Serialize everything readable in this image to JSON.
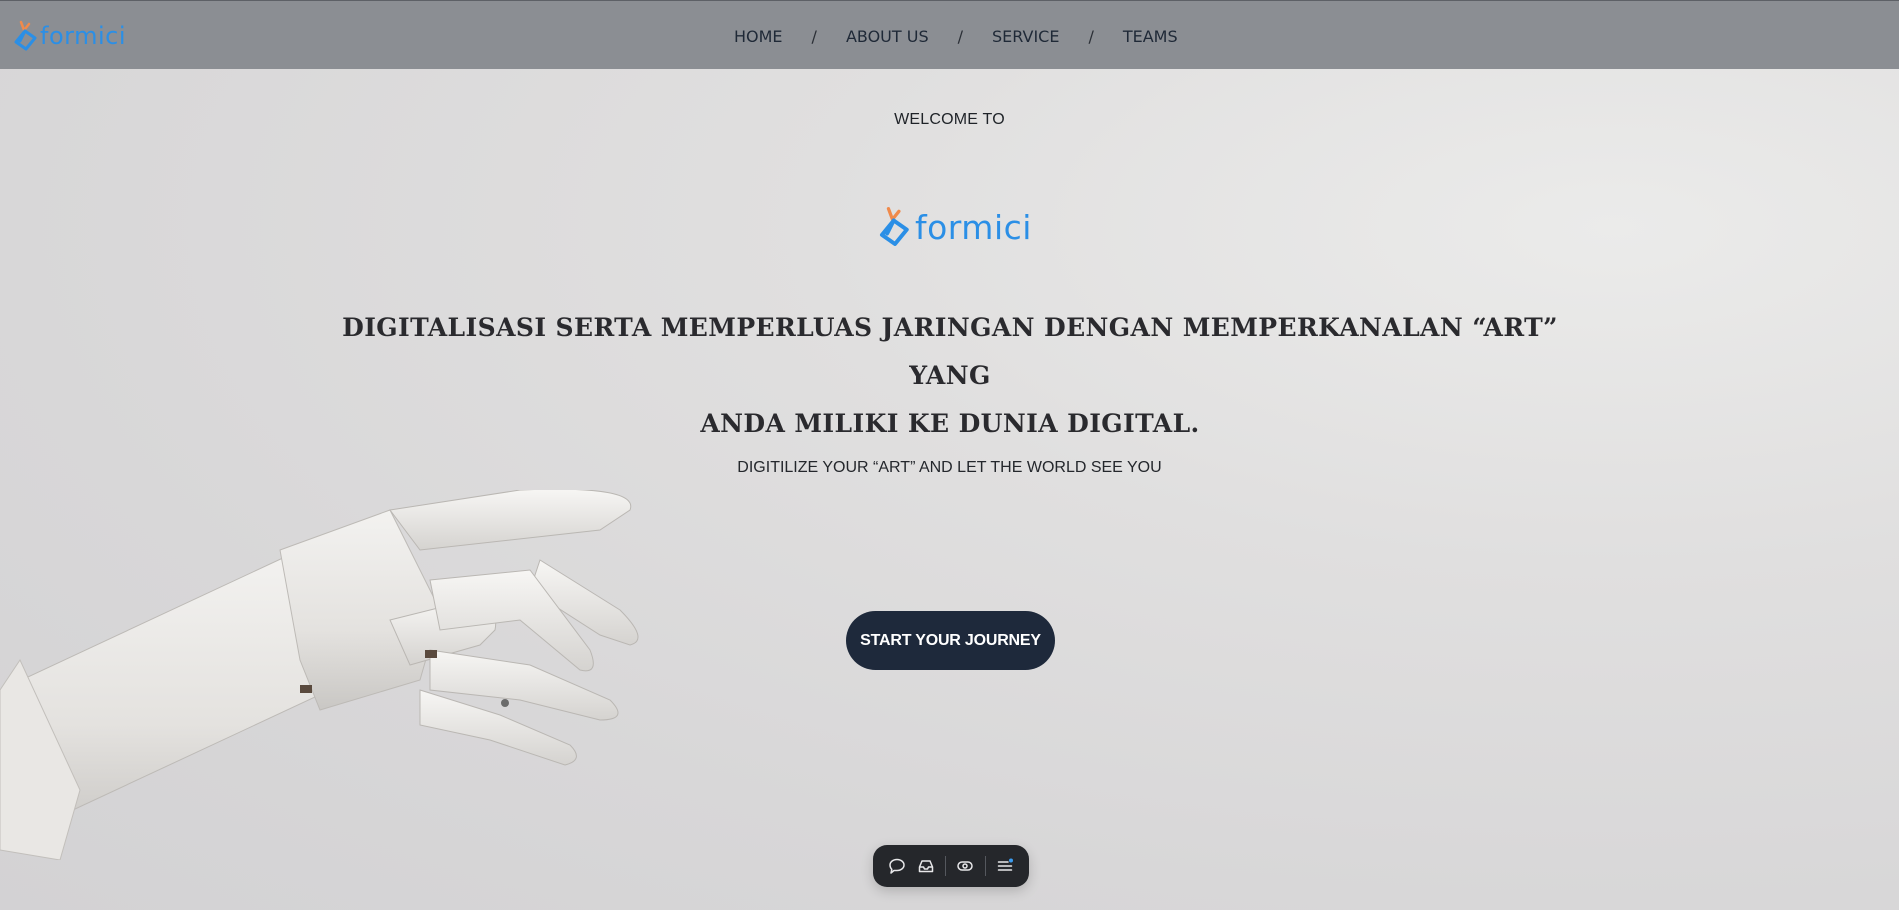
{
  "brand": {
    "name": "formici",
    "primary_color": "#2b8fe6",
    "accent_color": "#f08a4b"
  },
  "nav": {
    "items": [
      {
        "label": "HOME"
      },
      {
        "label": "ABOUT US"
      },
      {
        "label": "SERVICE"
      },
      {
        "label": "TEAMS"
      }
    ],
    "separator": "/"
  },
  "hero": {
    "welcome": "WELCOME TO",
    "headline_line1": "DIGITALISASI SERTA MEMPERLUAS JARINGAN DENGAN MEMPERKANALAN “ART” YANG",
    "headline_line2": "ANDA MILIKI KE DUNIA DIGITAL.",
    "tagline": "DIGITILIZE YOUR “ART” AND LET THE WORLD SEE YOU",
    "cta_label": "START YOUR JOURNEY"
  },
  "toolbar": {
    "items": [
      "comment-icon",
      "inbox-icon",
      "toggle-visibility-icon",
      "menu-icon"
    ]
  }
}
